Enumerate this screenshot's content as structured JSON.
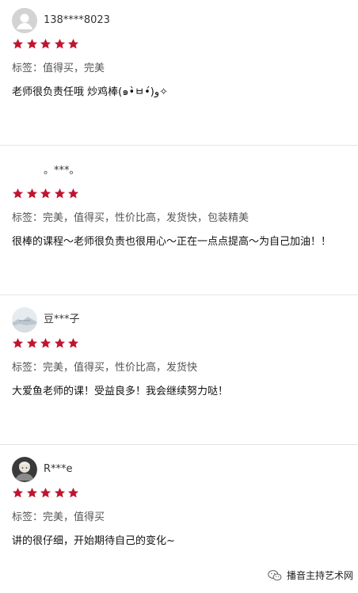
{
  "reviews": [
    {
      "username": "138****8023",
      "avatar": "default-user-avatar",
      "rating": 5,
      "tags": "标签：值得买，完美",
      "comment": "老师很负责任哦 炒鸡棒(๑•̀ㅂ•́)و✧"
    },
    {
      "username": "。***。",
      "avatar": "none",
      "rating": 5,
      "tags": "标签：完美，值得买，性价比高，发货快，包装精美",
      "comment": "很棒的课程～老师很负责也很用心～正在一点点提高～为自己加油！！"
    },
    {
      "username": "豆***子",
      "avatar": "landscape-avatar",
      "rating": 5,
      "tags": "标签：完美，值得买，性价比高，发货快",
      "comment": "大爱鱼老师的课！受益良多！我会继续努力哒！"
    },
    {
      "username": "R***e",
      "avatar": "photo-avatar",
      "rating": 5,
      "tags": "标签：完美，值得买",
      "comment": "讲的很仔细，开始期待自己的变化~"
    }
  ],
  "watermark": {
    "text": "播音主持艺术网",
    "icon": "wechat-icon"
  },
  "colors": {
    "star": "#c0152f",
    "divider": "#e5e5e5"
  }
}
